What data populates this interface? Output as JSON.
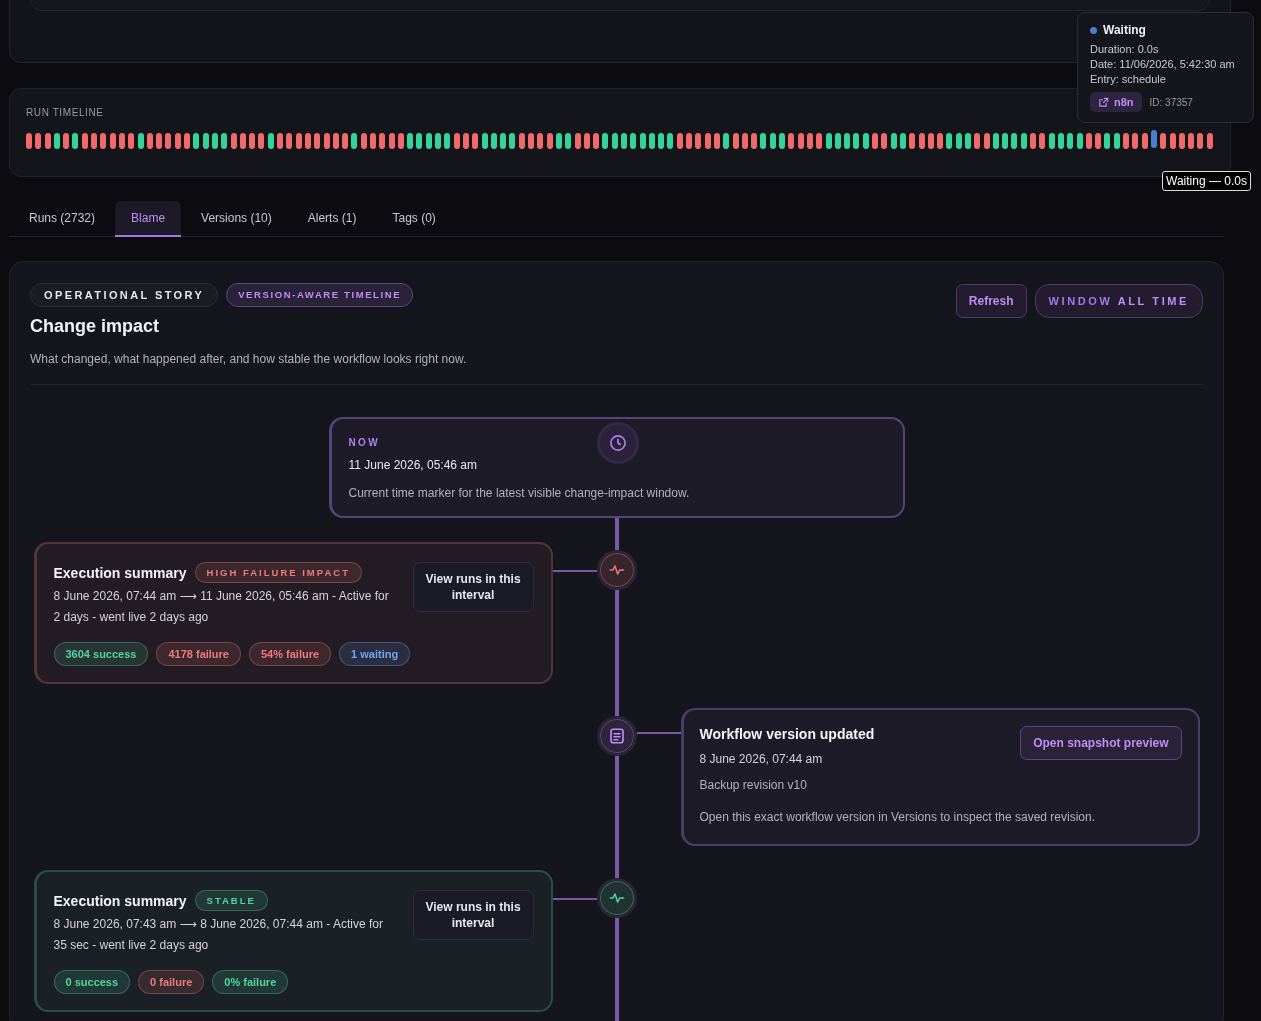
{
  "run_timeline": {
    "title": "RUN TIMELINE",
    "runs": [
      {
        "color": "#f06a6a",
        "hovered": false
      },
      {
        "color": "#f06a6a",
        "hovered": false
      },
      {
        "color": "#f06a6a",
        "hovered": false
      },
      {
        "color": "#33d39a",
        "hovered": false
      },
      {
        "color": "#f06a6a",
        "hovered": false
      },
      {
        "color": "#33d39a",
        "hovered": false
      },
      {
        "color": "#f06a6a",
        "hovered": false
      },
      {
        "color": "#f06a6a",
        "hovered": false
      },
      {
        "color": "#f06a6a",
        "hovered": false
      },
      {
        "color": "#f06a6a",
        "hovered": false
      },
      {
        "color": "#f06a6a",
        "hovered": false
      },
      {
        "color": "#f06a6a",
        "hovered": false
      },
      {
        "color": "#33d39a",
        "hovered": false
      },
      {
        "color": "#f06a6a",
        "hovered": false
      },
      {
        "color": "#f06a6a",
        "hovered": false
      },
      {
        "color": "#f06a6a",
        "hovered": false
      },
      {
        "color": "#f06a6a",
        "hovered": false
      },
      {
        "color": "#f06a6a",
        "hovered": false
      },
      {
        "color": "#33d39a",
        "hovered": false
      },
      {
        "color": "#33d39a",
        "hovered": false
      },
      {
        "color": "#33d39a",
        "hovered": false
      },
      {
        "color": "#33d39a",
        "hovered": false
      },
      {
        "color": "#f06a6a",
        "hovered": false
      },
      {
        "color": "#f06a6a",
        "hovered": false
      },
      {
        "color": "#f06a6a",
        "hovered": false
      },
      {
        "color": "#f06a6a",
        "hovered": false
      },
      {
        "color": "#33d39a",
        "hovered": false
      },
      {
        "color": "#f06a6a",
        "hovered": false
      },
      {
        "color": "#f06a6a",
        "hovered": false
      },
      {
        "color": "#f06a6a",
        "hovered": false
      },
      {
        "color": "#f06a6a",
        "hovered": false
      },
      {
        "color": "#f06a6a",
        "hovered": false
      },
      {
        "color": "#f06a6a",
        "hovered": false
      },
      {
        "color": "#f06a6a",
        "hovered": false
      },
      {
        "color": "#f06a6a",
        "hovered": false
      },
      {
        "color": "#33d39a",
        "hovered": false
      },
      {
        "color": "#f06a6a",
        "hovered": false
      },
      {
        "color": "#f06a6a",
        "hovered": false
      },
      {
        "color": "#f06a6a",
        "hovered": false
      },
      {
        "color": "#f06a6a",
        "hovered": false
      },
      {
        "color": "#f06a6a",
        "hovered": false
      },
      {
        "color": "#33d39a",
        "hovered": false
      },
      {
        "color": "#33d39a",
        "hovered": false
      },
      {
        "color": "#33d39a",
        "hovered": false
      },
      {
        "color": "#33d39a",
        "hovered": false
      },
      {
        "color": "#33d39a",
        "hovered": false
      },
      {
        "color": "#f06a6a",
        "hovered": false
      },
      {
        "color": "#f06a6a",
        "hovered": false
      },
      {
        "color": "#f06a6a",
        "hovered": false
      },
      {
        "color": "#33d39a",
        "hovered": false
      },
      {
        "color": "#33d39a",
        "hovered": false
      },
      {
        "color": "#33d39a",
        "hovered": false
      },
      {
        "color": "#33d39a",
        "hovered": false
      },
      {
        "color": "#f06a6a",
        "hovered": false
      },
      {
        "color": "#f06a6a",
        "hovered": false
      },
      {
        "color": "#f06a6a",
        "hovered": false
      },
      {
        "color": "#f06a6a",
        "hovered": false
      },
      {
        "color": "#33d39a",
        "hovered": false
      },
      {
        "color": "#33d39a",
        "hovered": false
      },
      {
        "color": "#f06a6a",
        "hovered": false
      },
      {
        "color": "#f06a6a",
        "hovered": false
      },
      {
        "color": "#f06a6a",
        "hovered": false
      },
      {
        "color": "#33d39a",
        "hovered": false
      },
      {
        "color": "#33d39a",
        "hovered": false
      },
      {
        "color": "#33d39a",
        "hovered": false
      },
      {
        "color": "#33d39a",
        "hovered": false
      },
      {
        "color": "#33d39a",
        "hovered": false
      },
      {
        "color": "#33d39a",
        "hovered": false
      },
      {
        "color": "#33d39a",
        "hovered": false
      },
      {
        "color": "#33d39a",
        "hovered": false
      },
      {
        "color": "#f06a6a",
        "hovered": false
      },
      {
        "color": "#f06a6a",
        "hovered": false
      },
      {
        "color": "#f06a6a",
        "hovered": false
      },
      {
        "color": "#f06a6a",
        "hovered": false
      },
      {
        "color": "#f06a6a",
        "hovered": false
      },
      {
        "color": "#33d39a",
        "hovered": false
      },
      {
        "color": "#f06a6a",
        "hovered": false
      },
      {
        "color": "#f06a6a",
        "hovered": false
      },
      {
        "color": "#f06a6a",
        "hovered": false
      },
      {
        "color": "#33d39a",
        "hovered": false
      },
      {
        "color": "#33d39a",
        "hovered": false
      },
      {
        "color": "#33d39a",
        "hovered": false
      },
      {
        "color": "#f06a6a",
        "hovered": false
      },
      {
        "color": "#f06a6a",
        "hovered": false
      },
      {
        "color": "#f06a6a",
        "hovered": false
      },
      {
        "color": "#f06a6a",
        "hovered": false
      },
      {
        "color": "#33d39a",
        "hovered": false
      },
      {
        "color": "#33d39a",
        "hovered": false
      },
      {
        "color": "#33d39a",
        "hovered": false
      },
      {
        "color": "#33d39a",
        "hovered": false
      },
      {
        "color": "#33d39a",
        "hovered": false
      },
      {
        "color": "#f06a6a",
        "hovered": false
      },
      {
        "color": "#f06a6a",
        "hovered": false
      },
      {
        "color": "#33d39a",
        "hovered": false
      },
      {
        "color": "#33d39a",
        "hovered": false
      },
      {
        "color": "#f06a6a",
        "hovered": false
      },
      {
        "color": "#f06a6a",
        "hovered": false
      },
      {
        "color": "#f06a6a",
        "hovered": false
      },
      {
        "color": "#f06a6a",
        "hovered": false
      },
      {
        "color": "#33d39a",
        "hovered": false
      },
      {
        "color": "#33d39a",
        "hovered": false
      },
      {
        "color": "#33d39a",
        "hovered": false
      },
      {
        "color": "#f06a6a",
        "hovered": false
      },
      {
        "color": "#f06a6a",
        "hovered": false
      },
      {
        "color": "#33d39a",
        "hovered": false
      },
      {
        "color": "#33d39a",
        "hovered": false
      },
      {
        "color": "#33d39a",
        "hovered": false
      },
      {
        "color": "#33d39a",
        "hovered": false
      },
      {
        "color": "#f06a6a",
        "hovered": false
      },
      {
        "color": "#f06a6a",
        "hovered": false
      },
      {
        "color": "#33d39a",
        "hovered": false
      },
      {
        "color": "#33d39a",
        "hovered": false
      },
      {
        "color": "#33d39a",
        "hovered": false
      },
      {
        "color": "#33d39a",
        "hovered": false
      },
      {
        "color": "#f06a6a",
        "hovered": false
      },
      {
        "color": "#f06a6a",
        "hovered": false
      },
      {
        "color": "#33d39a",
        "hovered": false
      },
      {
        "color": "#33d39a",
        "hovered": false
      },
      {
        "color": "#f06a6a",
        "hovered": false
      },
      {
        "color": "#f06a6a",
        "hovered": false
      },
      {
        "color": "#f06a6a",
        "hovered": false
      },
      {
        "color": "#4a7fd0",
        "hovered": true
      },
      {
        "color": "#f06a6a",
        "hovered": false
      },
      {
        "color": "#f06a6a",
        "hovered": false
      },
      {
        "color": "#f06a6a",
        "hovered": false
      },
      {
        "color": "#f06a6a",
        "hovered": false
      },
      {
        "color": "#f06a6a",
        "hovered": false
      },
      {
        "color": "#f06a6a",
        "hovered": false
      }
    ],
    "tooltip": {
      "status": "Waiting",
      "color": "#4a7fd0",
      "duration": "Duration: 0.0s",
      "date": "Date: 11/06/2026, 5:42:30 am",
      "entry": "Entry: schedule",
      "link": "n8n",
      "id": "ID: 37357"
    },
    "hover_hint": "Waiting — 0.0s"
  },
  "tabs": [
    {
      "label": "Runs (2732)",
      "selected": false
    },
    {
      "label": "Blame",
      "selected": true
    },
    {
      "label": "Versions (10)",
      "selected": false
    },
    {
      "label": "Alerts (1)",
      "selected": false
    },
    {
      "label": "Tags (0)",
      "selected": false
    }
  ],
  "panel": {
    "pills": [
      {
        "label": "OPERATIONAL STORY",
        "kind": "plain"
      },
      {
        "label": "VERSION-AWARE TIMELINE",
        "kind": "accent"
      }
    ],
    "title": "Change impact",
    "subtitle": "What changed, what happened after, and how stable the workflow looks right now.",
    "refresh": "Refresh",
    "window": {
      "label": "WINDOW",
      "value": "ALL TIME"
    },
    "timeline": [
      {
        "kind": "now",
        "label": "NOW",
        "time": "11 June 2026, 05:46 am",
        "text": "Current time marker for the latest visible change-impact window."
      },
      {
        "kind": "execution",
        "color": "#f07a7a",
        "title": "Execution summary",
        "badge": "HIGH FAILURE IMPACT",
        "range": "8 June 2026, 07:44 am ⟶ 11 June 2026, 05:46 am - Active for 2 days - went live 2 days ago",
        "action": "View runs in this interval",
        "stats": [
          {
            "label": "3604 success",
            "color": "#4fd6a2"
          },
          {
            "label": "4178 failure",
            "color": "#f07a7a"
          },
          {
            "label": "54% failure",
            "color": "#f07a7a"
          },
          {
            "label": "1 waiting",
            "color": "#6aa8f5"
          }
        ]
      },
      {
        "kind": "version",
        "title": "Workflow version updated",
        "time": "8 June 2026, 07:44 am",
        "revision": "Backup revision v10",
        "text": "Open this exact workflow version in Versions to inspect the saved revision.",
        "action": "Open snapshot preview"
      },
      {
        "kind": "execution",
        "color": "#4fd6a2",
        "title": "Execution summary",
        "badge": "STABLE",
        "range": "8 June 2026, 07:43 am ⟶ 8 June 2026, 07:44 am - Active for 35 sec - went live 2 days ago",
        "action": "View runs in this interval",
        "stats": [
          {
            "label": "0 success",
            "color": "#4fd6a2"
          },
          {
            "label": "0 failure",
            "color": "#f07a7a"
          },
          {
            "label": "0% failure",
            "color": "#4fd6a2"
          }
        ]
      }
    ]
  }
}
